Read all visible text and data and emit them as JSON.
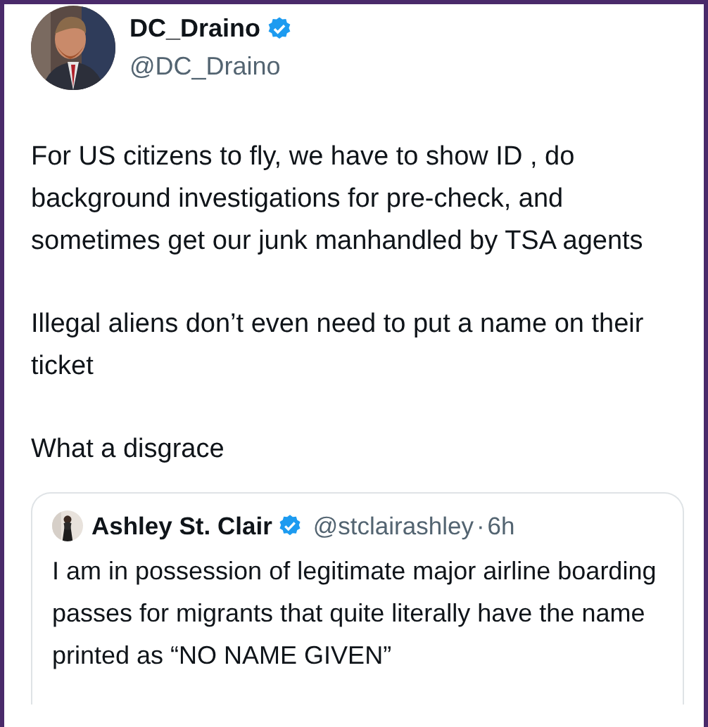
{
  "author": {
    "name": "DC_Draino",
    "verified": true,
    "handle": "@DC_Draino"
  },
  "paragraphs": [
    "For US citizens to fly, we have to show ID , do background investigations for pre-check, and sometimes get our junk manhandled by TSA agents",
    "Illegal aliens don’t even need to put a name on their ticket",
    "What a disgrace"
  ],
  "quote": {
    "name": "Ashley St. Clair",
    "verified": true,
    "handle": "@stclairashley",
    "separator": "·",
    "time": "6h",
    "text": "I am in possession of legitimate major airline boarding passes for migrants that quite literally have the name printed as “NO NAME GIVEN”"
  }
}
